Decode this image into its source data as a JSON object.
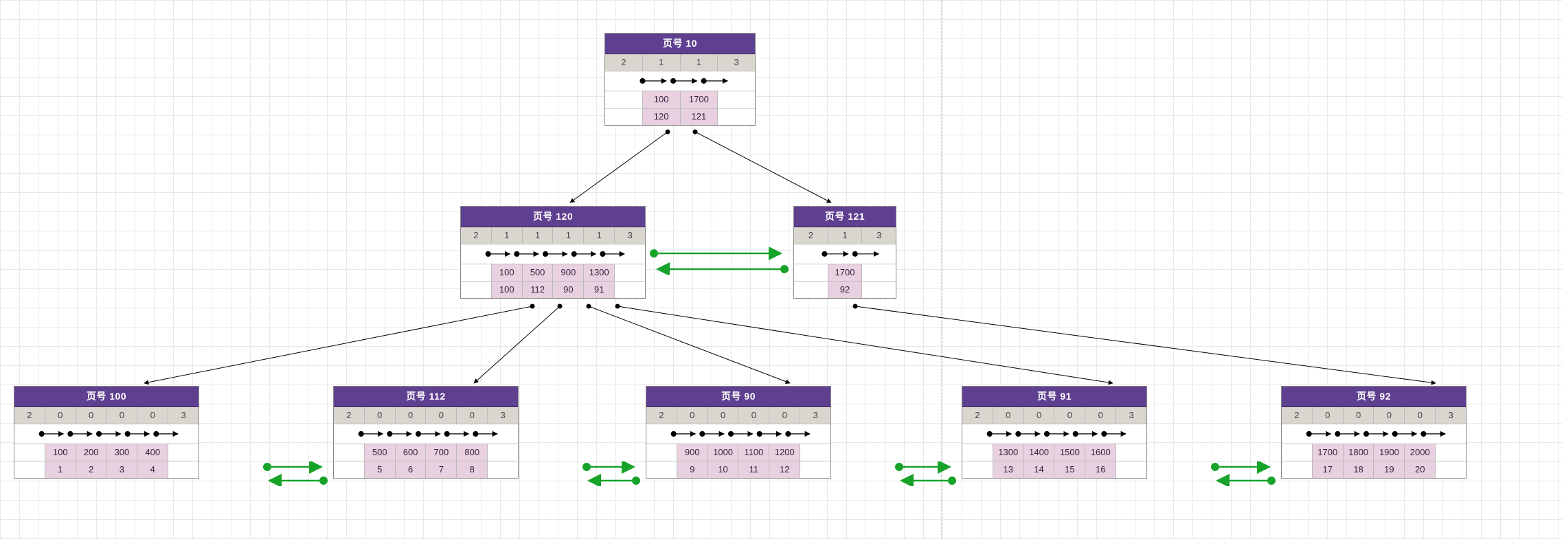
{
  "root": {
    "title": "页号 10",
    "spec": [
      "2",
      "1",
      "1",
      "3"
    ],
    "keys": [
      "",
      "100",
      "1700",
      ""
    ],
    "ptrs": [
      "",
      "120",
      "121",
      ""
    ]
  },
  "mid_left": {
    "title": "页号 120",
    "spec": [
      "2",
      "1",
      "1",
      "1",
      "1",
      "3"
    ],
    "keys": [
      "",
      "100",
      "500",
      "900",
      "1300",
      ""
    ],
    "ptrs": [
      "",
      "100",
      "112",
      "90",
      "91",
      ""
    ]
  },
  "mid_right": {
    "title": "页号 121",
    "spec": [
      "2",
      "1",
      "3"
    ],
    "keys": [
      "",
      "1700",
      ""
    ],
    "ptrs": [
      "",
      "92",
      ""
    ]
  },
  "leaves": [
    {
      "title": "页号 100",
      "spec": [
        "2",
        "0",
        "0",
        "0",
        "0",
        "3"
      ],
      "keys": [
        "",
        "100",
        "200",
        "300",
        "400",
        ""
      ],
      "vals": [
        "",
        "1",
        "2",
        "3",
        "4",
        ""
      ]
    },
    {
      "title": "页号 112",
      "spec": [
        "2",
        "0",
        "0",
        "0",
        "0",
        "3"
      ],
      "keys": [
        "",
        "500",
        "600",
        "700",
        "800",
        ""
      ],
      "vals": [
        "",
        "5",
        "6",
        "7",
        "8",
        ""
      ]
    },
    {
      "title": "页号 90",
      "spec": [
        "2",
        "0",
        "0",
        "0",
        "0",
        "3"
      ],
      "keys": [
        "",
        "900",
        "1000",
        "1100",
        "1200",
        ""
      ],
      "vals": [
        "",
        "9",
        "10",
        "11",
        "12",
        ""
      ]
    },
    {
      "title": "页号 91",
      "spec": [
        "2",
        "0",
        "0",
        "0",
        "0",
        "3"
      ],
      "keys": [
        "",
        "1300",
        "1400",
        "1500",
        "1600",
        ""
      ],
      "vals": [
        "",
        "13",
        "14",
        "15",
        "16",
        ""
      ]
    },
    {
      "title": "页号 92",
      "spec": [
        "2",
        "0",
        "0",
        "0",
        "0",
        "3"
      ],
      "keys": [
        "",
        "1700",
        "1800",
        "1900",
        "2000",
        ""
      ],
      "vals": [
        "",
        "17",
        "18",
        "19",
        "20",
        ""
      ]
    }
  ]
}
